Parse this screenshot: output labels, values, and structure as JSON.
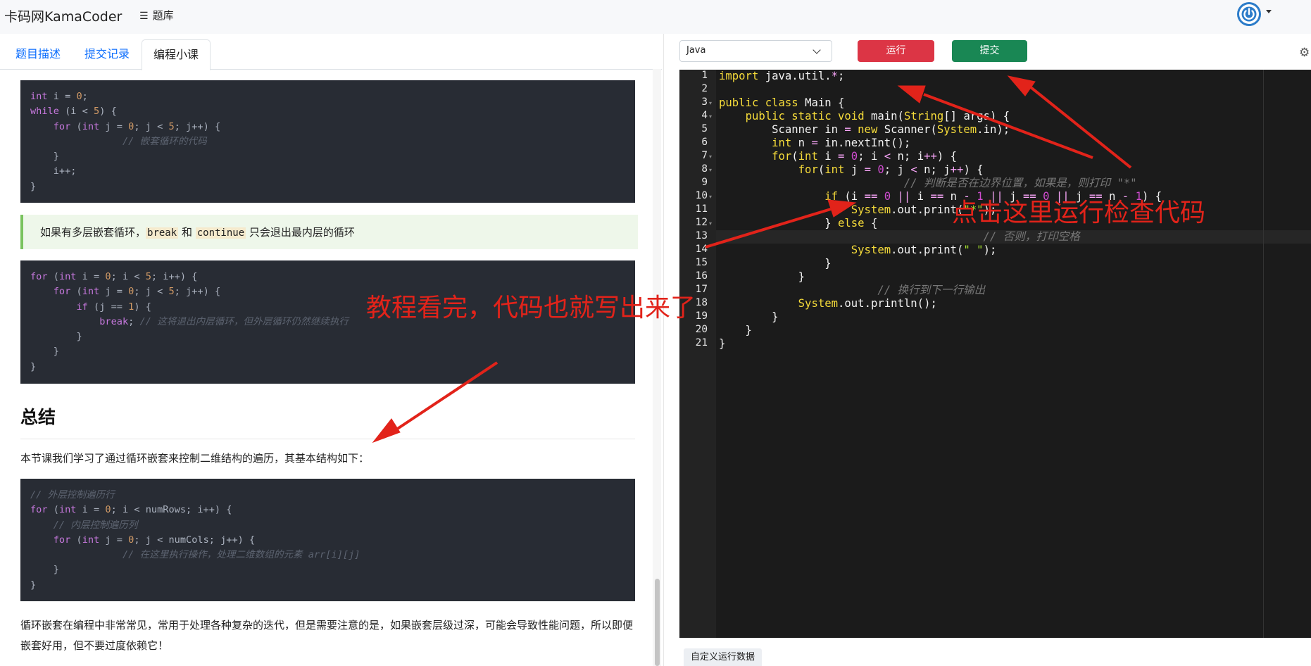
{
  "navbar": {
    "brand": "卡码网KamaCoder",
    "bank_icon": "hamburger-icon",
    "bank_label": "题库"
  },
  "left": {
    "tabs": [
      "题目描述",
      "提交记录",
      "编程小课"
    ],
    "code1": [
      "int i = 0;",
      "while (i < 5) {",
      "    for (int j = 0; j < 5; j++) {",
      "        // 嵌套循环的代码",
      "    }",
      "    i++;",
      "}"
    ],
    "quote": {
      "prefix": "如果有多层嵌套循环，",
      "code1": "break",
      "mid": " 和 ",
      "code2": "continue",
      "suffix": " 只会退出最内层的循环"
    },
    "code2": [
      "for (int i = 0; i < 5; i++) {",
      "    for (int j = 0; j < 5; j++) {",
      "        if (j == 1) {",
      "            break; // 这将退出内层循环，但外层循环仍然继续执行",
      "        }",
      "    }",
      "}"
    ],
    "summary_heading": "总结",
    "summary_para": "本节课我们学习了通过循环嵌套来控制二维结构的遍历，其基本结构如下：",
    "code3": [
      "// 外层控制遍历行",
      "for (int i = 0; i < numRows; i++) {",
      "  // 内层控制遍历列",
      "    for (int j = 0; j < numCols; j++) {",
      "        // 在这里执行操作，处理二维数组的元素 arr[i][j]",
      "    }",
      "}"
    ],
    "closing_para": "循环嵌套在编程中非常常见，常用于处理各种复杂的迭代，但是需要注意的是，如果嵌套层级过深，可能会导致性能问题，所以即便嵌套好用，但不要过度依赖它！"
  },
  "right": {
    "language": "Java",
    "run_label": "运行",
    "submit_label": "提交",
    "settings_icon": "gear-icon",
    "line_numbers": [
      "1",
      "2",
      "3",
      "4",
      "5",
      "6",
      "7",
      "8",
      "9",
      "10",
      "11",
      "12",
      "13",
      "14",
      "15",
      "16",
      "17",
      "18",
      "19",
      "20",
      "21"
    ],
    "code": [
      "import java.util.*;",
      "",
      "public class Main {",
      "    public static void main(String[] args) {",
      "        Scanner in = new Scanner(System.in);",
      "        int n = in.nextInt();",
      "        for(int i = 0; i < n; i++) {",
      "            for(int j = 0; j < n; j++) {",
      "              // 判断是否在边界位置，如果是，则打印 \"*\"",
      "                if (i == 0 || i == n - 1 || j == 0 || j == n - 1) {",
      "                    System.out.print(\"*\");",
      "                } else {",
      "                    // 否则，打印空格",
      "                    System.out.print(\" \");",
      "                }",
      "            }",
      "            // 换行到下一行输出",
      "            System.out.println();",
      "        }",
      "    }",
      "}"
    ],
    "custom_data_tab": "自定义运行数据"
  },
  "annotations": {
    "tutorial": "教程看完，代码也就写出来了",
    "run_hint": "点击这里运行检查代码",
    "color": "#e2231a"
  }
}
